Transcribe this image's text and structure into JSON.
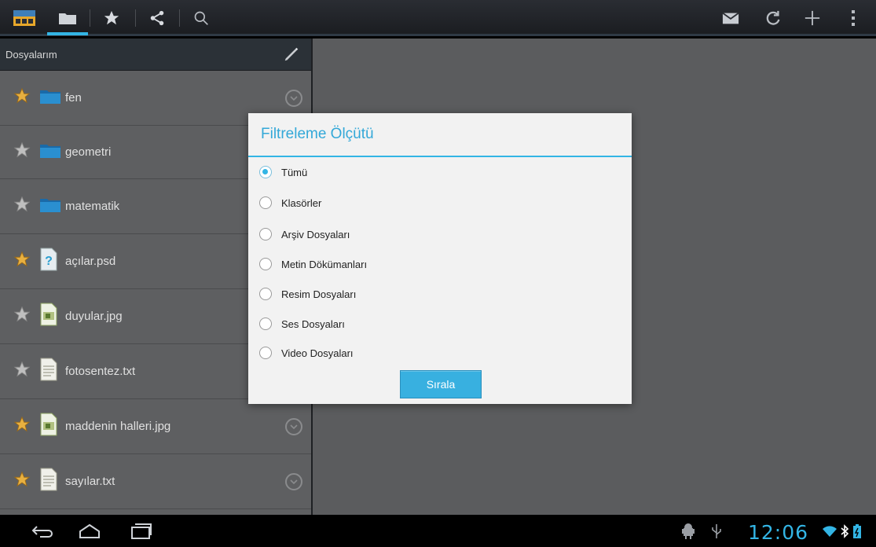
{
  "action_bar": {
    "icons": [
      "app-home-icon",
      "folder-icon",
      "star-icon",
      "share-icon",
      "search-icon",
      "mail-icon",
      "refresh-icon",
      "plus-icon",
      "overflow-menu-icon"
    ]
  },
  "left_pane": {
    "header": "Dosyalarım",
    "items": [
      {
        "label": "fen",
        "type": "folder",
        "starred": true,
        "has_menu": true
      },
      {
        "label": "geometri",
        "type": "folder",
        "starred": false,
        "has_menu": false
      },
      {
        "label": "matematik",
        "type": "folder",
        "starred": false,
        "has_menu": false
      },
      {
        "label": "açılar.psd",
        "type": "unknown",
        "starred": true,
        "has_menu": false
      },
      {
        "label": "duyular.jpg",
        "type": "image",
        "starred": false,
        "has_menu": false
      },
      {
        "label": "fotosentez.txt",
        "type": "text",
        "starred": false,
        "has_menu": false
      },
      {
        "label": "maddenin halleri.jpg",
        "type": "image",
        "starred": true,
        "has_menu": true
      },
      {
        "label": "sayılar.txt",
        "type": "text",
        "starred": true,
        "has_menu": true
      }
    ]
  },
  "dialog": {
    "title": "Filtreleme Ölçütü",
    "options": [
      {
        "label": "Tümü",
        "selected": true
      },
      {
        "label": "Klasörler",
        "selected": false
      },
      {
        "label": "Arşiv Dosyaları",
        "selected": false
      },
      {
        "label": "Metin Dökümanları",
        "selected": false
      },
      {
        "label": "Resim Dosyaları",
        "selected": false
      },
      {
        "label": "Ses Dosyaları",
        "selected": false
      },
      {
        "label": "Video Dosyaları",
        "selected": false
      }
    ],
    "button": "Sırala"
  },
  "status_bar": {
    "time": "12:06"
  },
  "colors": {
    "accent": "#33b5e5",
    "dialog_bg": "#f2f2f2",
    "pane_bg": "#5b5c5e"
  }
}
